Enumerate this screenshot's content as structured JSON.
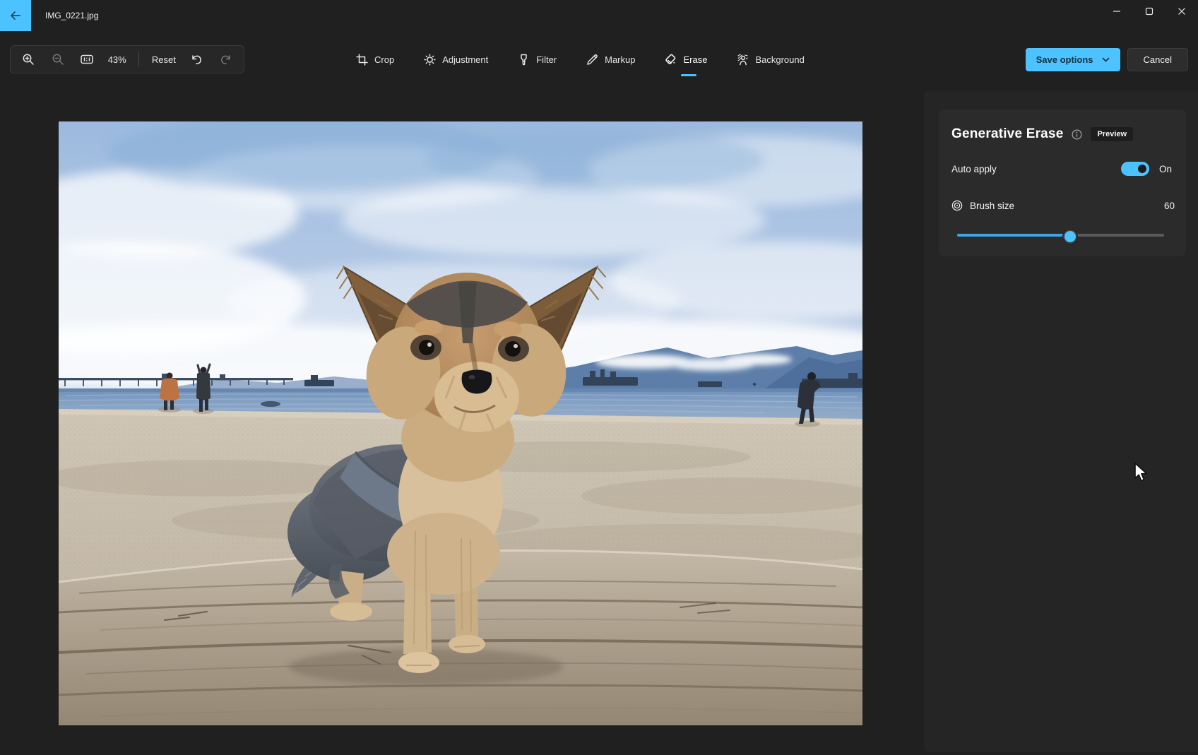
{
  "window": {
    "title": "IMG_0221.jpg",
    "controls": [
      "minimize",
      "maximize",
      "close"
    ],
    "back_icon": "arrow-left"
  },
  "toolbar": {
    "zoom_in_icon": "magnifier-plus",
    "zoom_out_icon": "magnifier-minus",
    "actual_size_icon": "one-to-one",
    "zoom_value": "43%",
    "reset_label": "Reset",
    "undo_icon": "undo-arrow",
    "redo_icon": "redo-arrow"
  },
  "tabs": [
    {
      "label": "Crop",
      "icon": "crop-icon",
      "active": false
    },
    {
      "label": "Adjustment",
      "icon": "brightness-icon",
      "active": false
    },
    {
      "label": "Filter",
      "icon": "filter-icon",
      "active": false
    },
    {
      "label": "Markup",
      "icon": "pen-icon",
      "active": false
    },
    {
      "label": "Erase",
      "icon": "eraser-icon",
      "active": true
    },
    {
      "label": "Background",
      "icon": "background-person-icon",
      "active": false
    }
  ],
  "actions": {
    "save_label": "Save options",
    "save_chevron_icon": "chevron-down",
    "cancel_label": "Cancel"
  },
  "panel": {
    "title": "Generative Erase",
    "info_icon": "info-circle",
    "badge": "Preview",
    "auto_apply": {
      "label": "Auto apply",
      "state": "On",
      "enabled": true
    },
    "brush": {
      "icon": "concentric-circles",
      "label": "Brush size",
      "value": "60",
      "slider_percent": 55
    }
  },
  "colors": {
    "accent": "#4cc2ff",
    "app_bg": "#202020",
    "panel_bg": "#252525",
    "card_bg": "#2b2b2b",
    "slider_fill": "#3aa8e8"
  },
  "photo": {
    "description_visible_content": "Yorkshire terrier standing on driftwood at a beach"
  }
}
